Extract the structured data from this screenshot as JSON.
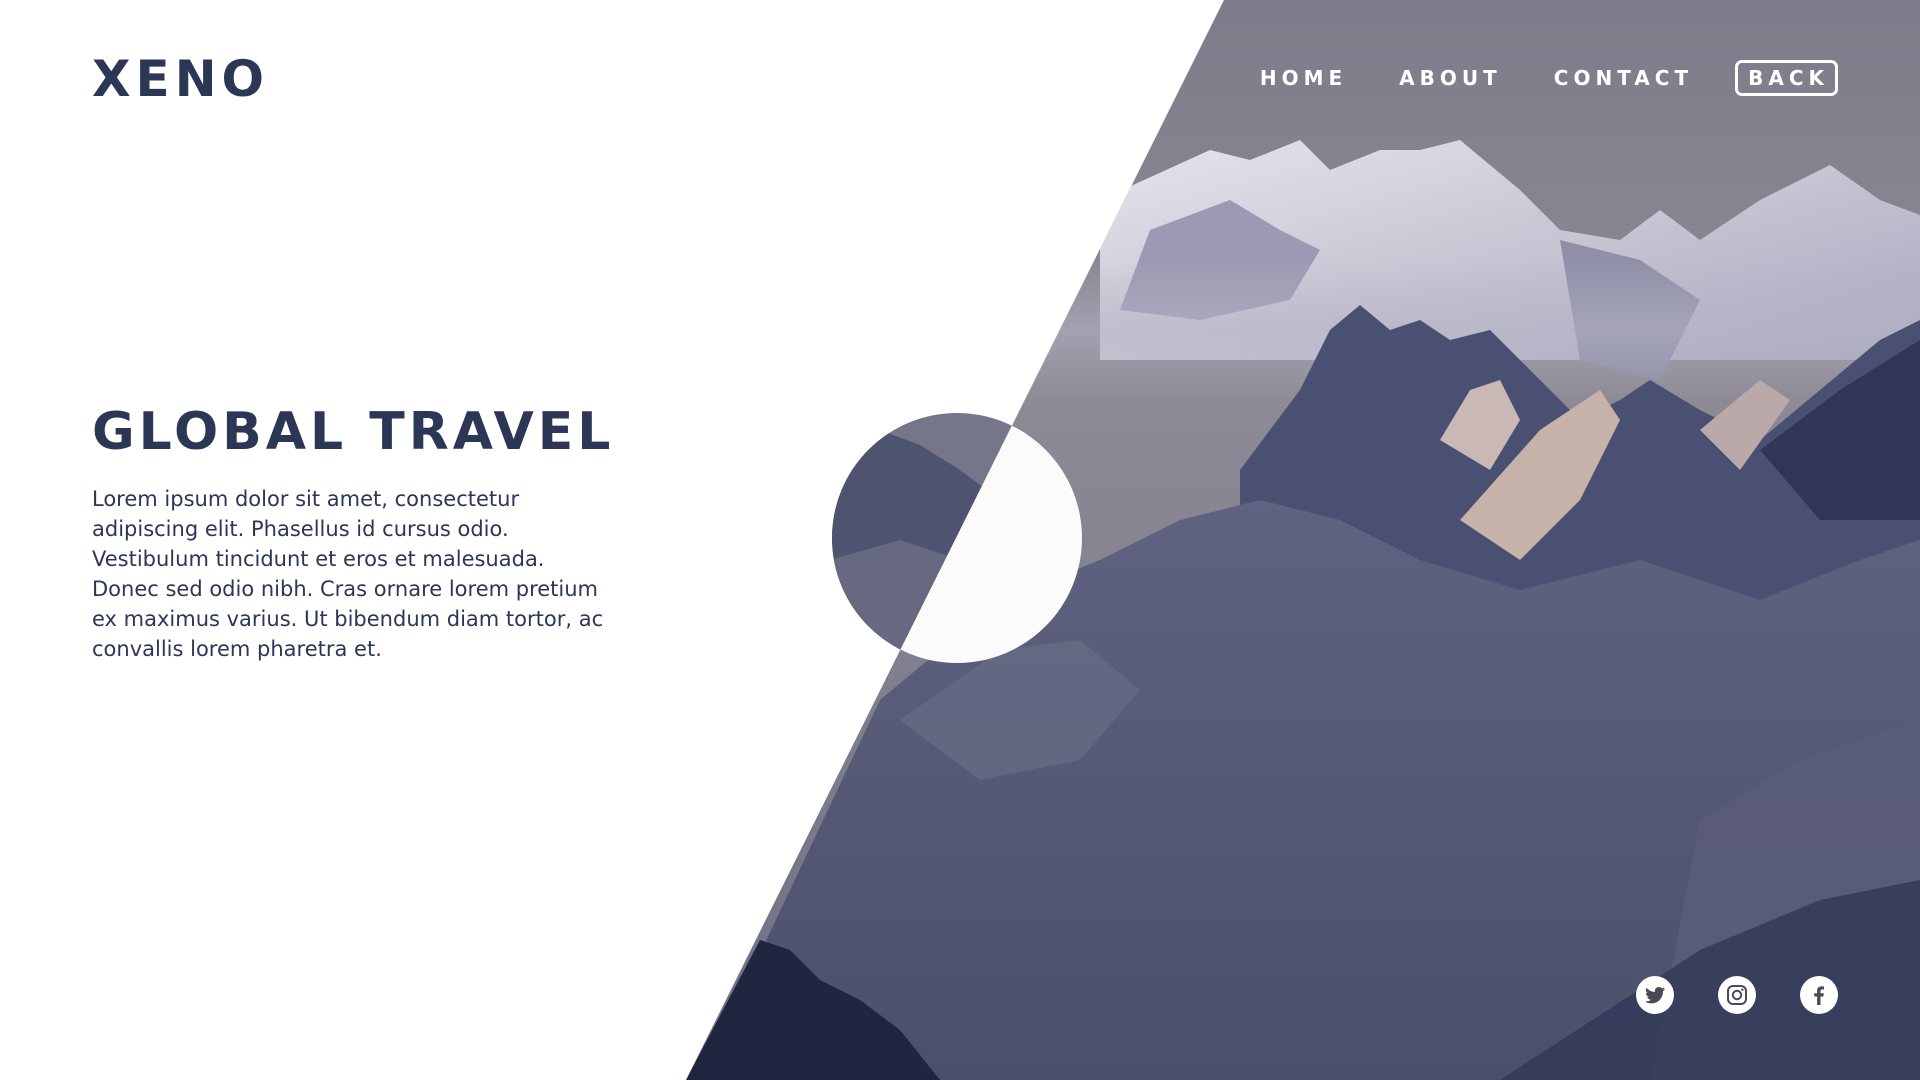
{
  "brand": {
    "logo": "XENO"
  },
  "nav": {
    "items": [
      {
        "label": "HOME"
      },
      {
        "label": "ABOUT"
      },
      {
        "label": "CONTACT"
      }
    ],
    "back_label": "BACK"
  },
  "hero": {
    "title": "GLOBAL TRAVEL",
    "body": "Lorem ipsum dolor sit amet, consectetur adipiscing elit. Phasellus id cursus odio. Vestibulum tincidunt et eros et malesuada. Donec sed odio nibh. Cras ornare lorem pretium ex maximus varius. Ut bibendum diam tortor, ac convallis lorem pharetra et."
  },
  "social": [
    {
      "icon": "twitter-icon"
    },
    {
      "icon": "instagram-icon"
    },
    {
      "icon": "facebook-icon"
    }
  ],
  "colors": {
    "text": "#2c3655",
    "background": "#ffffff",
    "nav_text": "#ffffff",
    "photo_sky": "#7a7a88",
    "photo_mountains": "#3a4468"
  }
}
